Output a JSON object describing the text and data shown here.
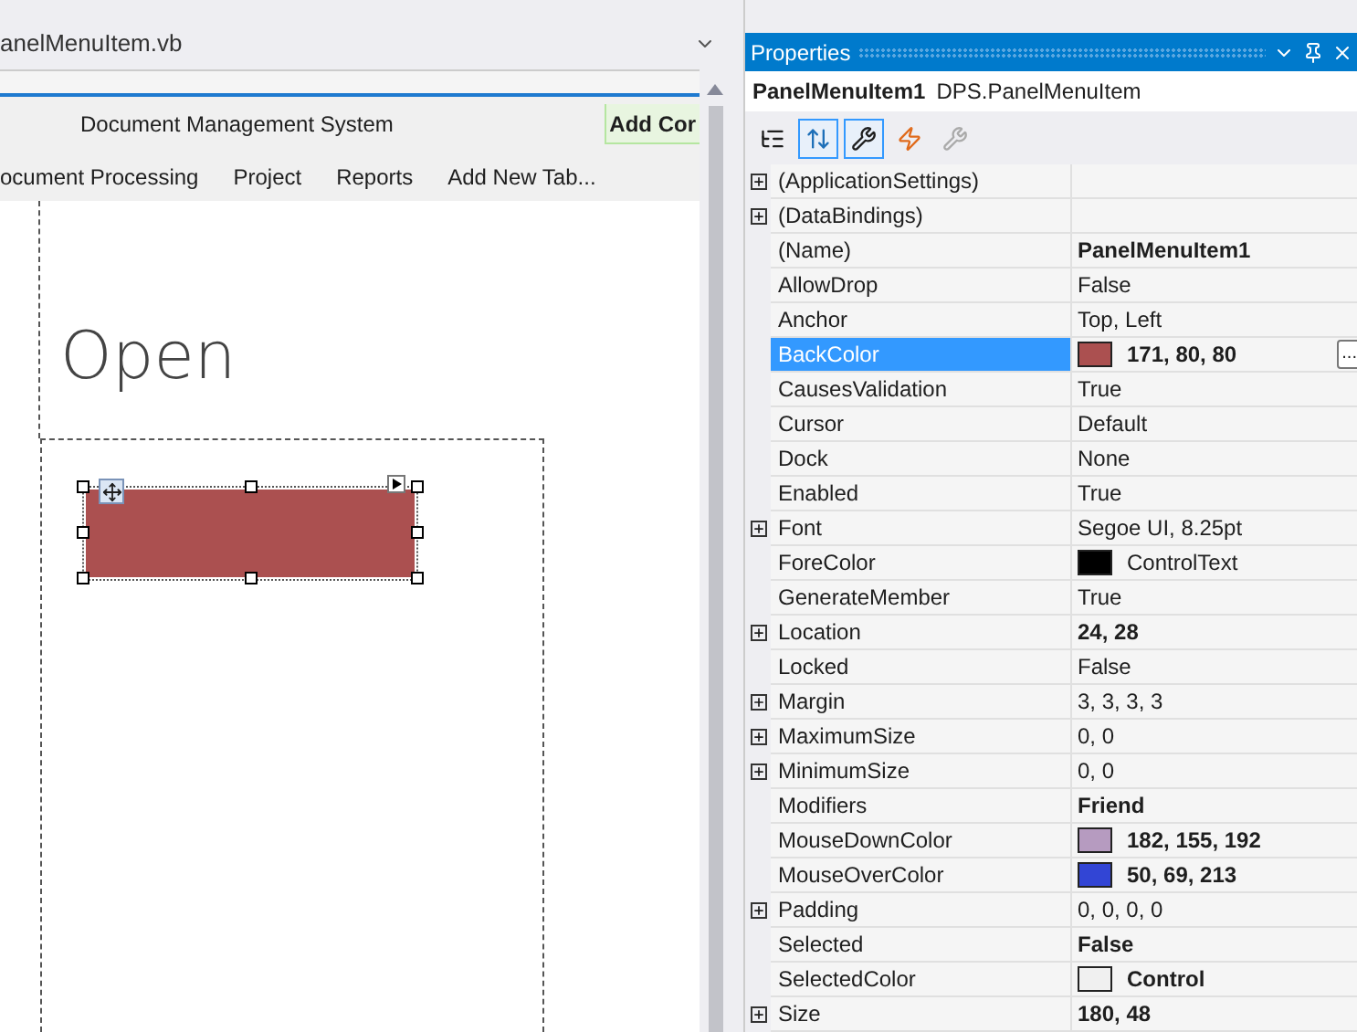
{
  "document_tab": {
    "title": "anelMenuItem.vb"
  },
  "form": {
    "title": "Document Management System",
    "add_button": "Add Cor",
    "menu": [
      "ocument Processing",
      "Project",
      "Reports",
      "Add New Tab..."
    ],
    "heading": "Open"
  },
  "properties": {
    "title": "Properties",
    "object_name": "PanelMenuItem1",
    "object_type": "DPS.PanelMenuItem",
    "toolbar": [
      {
        "kind": "categorized",
        "selected": false
      },
      {
        "kind": "alphabetical",
        "selected": true
      },
      {
        "kind": "properties",
        "selected": true
      },
      {
        "kind": "events",
        "selected": false
      },
      {
        "kind": "pages",
        "selected": false
      }
    ],
    "rows": [
      {
        "name": "(ApplicationSettings)",
        "expandable": true,
        "selected": false
      },
      {
        "name": "(DataBindings)",
        "expandable": true,
        "selected": false
      },
      {
        "name": "(Name)",
        "value": "PanelMenuItem1",
        "expandable": false,
        "bold": true,
        "selected": false
      },
      {
        "name": "AllowDrop",
        "value": "False",
        "expandable": false,
        "bold": false,
        "selected": false
      },
      {
        "name": "Anchor",
        "value": "Top, Left",
        "expandable": false,
        "bold": false,
        "selected": false
      },
      {
        "name": "BackColor",
        "value": "171, 80, 80",
        "expandable": false,
        "bold": true,
        "selected": true,
        "color": "#ab5050",
        "ellipsis": "..."
      },
      {
        "name": "CausesValidation",
        "value": "True",
        "expandable": false,
        "bold": false,
        "selected": false
      },
      {
        "name": "Cursor",
        "value": "Default",
        "expandable": false,
        "bold": false,
        "selected": false
      },
      {
        "name": "Dock",
        "value": "None",
        "expandable": false,
        "bold": false,
        "selected": false
      },
      {
        "name": "Enabled",
        "value": "True",
        "expandable": false,
        "bold": false,
        "selected": false
      },
      {
        "name": "Font",
        "value": "Segoe UI, 8.25pt",
        "expandable": true,
        "bold": false,
        "selected": false
      },
      {
        "name": "ForeColor",
        "value": "ControlText",
        "expandable": false,
        "bold": false,
        "selected": false,
        "color": "#000000"
      },
      {
        "name": "GenerateMember",
        "value": "True",
        "expandable": false,
        "bold": false,
        "selected": false
      },
      {
        "name": "Location",
        "value": "24, 28",
        "expandable": true,
        "bold": true,
        "selected": false
      },
      {
        "name": "Locked",
        "value": "False",
        "expandable": false,
        "bold": false,
        "selected": false
      },
      {
        "name": "Margin",
        "value": "3, 3, 3, 3",
        "expandable": true,
        "bold": false,
        "selected": false
      },
      {
        "name": "MaximumSize",
        "value": "0, 0",
        "expandable": true,
        "bold": false,
        "selected": false
      },
      {
        "name": "MinimumSize",
        "value": "0, 0",
        "expandable": true,
        "bold": false,
        "selected": false
      },
      {
        "name": "Modifiers",
        "value": "Friend",
        "expandable": false,
        "bold": true,
        "selected": false
      },
      {
        "name": "MouseDownColor",
        "value": "182, 155, 192",
        "expandable": false,
        "bold": true,
        "selected": false,
        "color": "#b69bc0"
      },
      {
        "name": "MouseOverColor",
        "value": "50, 69, 213",
        "expandable": false,
        "bold": true,
        "selected": false,
        "color": "#3245d5"
      },
      {
        "name": "Padding",
        "value": "0, 0, 0, 0",
        "expandable": true,
        "bold": false,
        "selected": false
      },
      {
        "name": "Selected",
        "value": "False",
        "expandable": false,
        "bold": true,
        "selected": false
      },
      {
        "name": "SelectedColor",
        "value": "Control",
        "expandable": false,
        "bold": true,
        "selected": false,
        "color": "#f0f0f0"
      },
      {
        "name": "Size",
        "value": "180, 48",
        "expandable": true,
        "bold": true,
        "selected": false
      }
    ]
  }
}
